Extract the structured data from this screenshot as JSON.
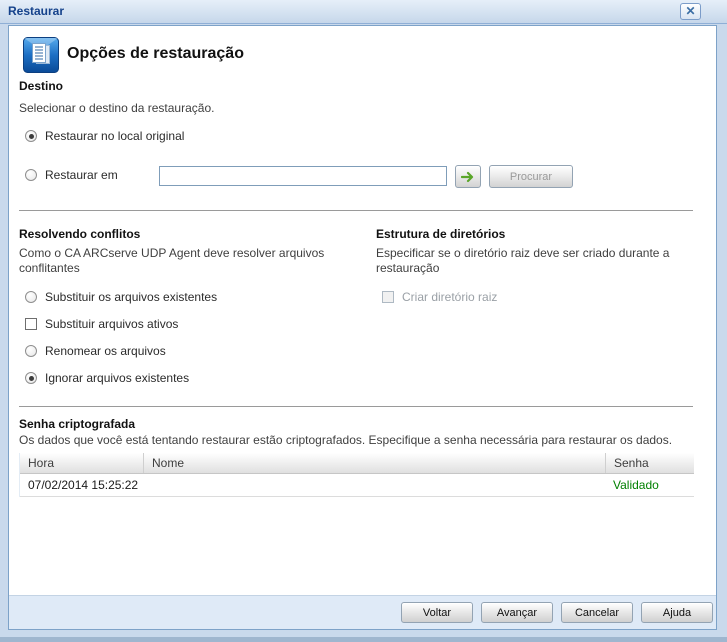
{
  "window": {
    "title": "Restaurar",
    "close_glyph": "✕"
  },
  "header": {
    "title": "Opções de restauração"
  },
  "destination": {
    "heading": "Destino",
    "description": "Selecionar o destino da restauração.",
    "option_original": {
      "label": "Restaurar no local original",
      "selected": true
    },
    "option_alternate": {
      "label": "Restaurar em",
      "selected": false
    },
    "path_value": "",
    "browse_label": "Procurar",
    "browse_disabled": true
  },
  "conflicts": {
    "heading": "Resolvendo conflitos",
    "description": "Como o CA ARCserve UDP Agent deve resolver arquivos conflitantes",
    "options": [
      {
        "type": "radio",
        "label": "Substituir os arquivos existentes",
        "selected": false
      },
      {
        "type": "checkbox",
        "label": "Substituir arquivos ativos",
        "checked": false
      },
      {
        "type": "radio",
        "label": "Renomear os arquivos",
        "selected": false
      },
      {
        "type": "radio",
        "label": "Ignorar arquivos existentes",
        "selected": true
      }
    ]
  },
  "directory_structure": {
    "heading": "Estrutura de diretórios",
    "description": "Especificar se o diretório raiz deve ser criado durante a restauração",
    "checkbox_label": "Criar diretório raiz",
    "checkbox_disabled": true,
    "checked": false
  },
  "encrypted_password": {
    "heading": "Senha criptografada",
    "description": "Os dados que você está tentando restaurar estão criptografados. Especifique a senha necessária para restaurar os dados.",
    "table": {
      "columns": {
        "hora": "Hora",
        "nome": "Nome",
        "senha": "Senha"
      },
      "row": {
        "hora": "07/02/2014 15:25:22",
        "nome": "",
        "senha": "Validado"
      }
    }
  },
  "footer": {
    "back_label": "Voltar",
    "next_label": "Avançar",
    "cancel_label": "Cancelar",
    "help_label": "Ajuda"
  },
  "colors": {
    "validated_green": "#008000",
    "arrow_green": "#5aa629",
    "title_blue": "#15428b"
  }
}
